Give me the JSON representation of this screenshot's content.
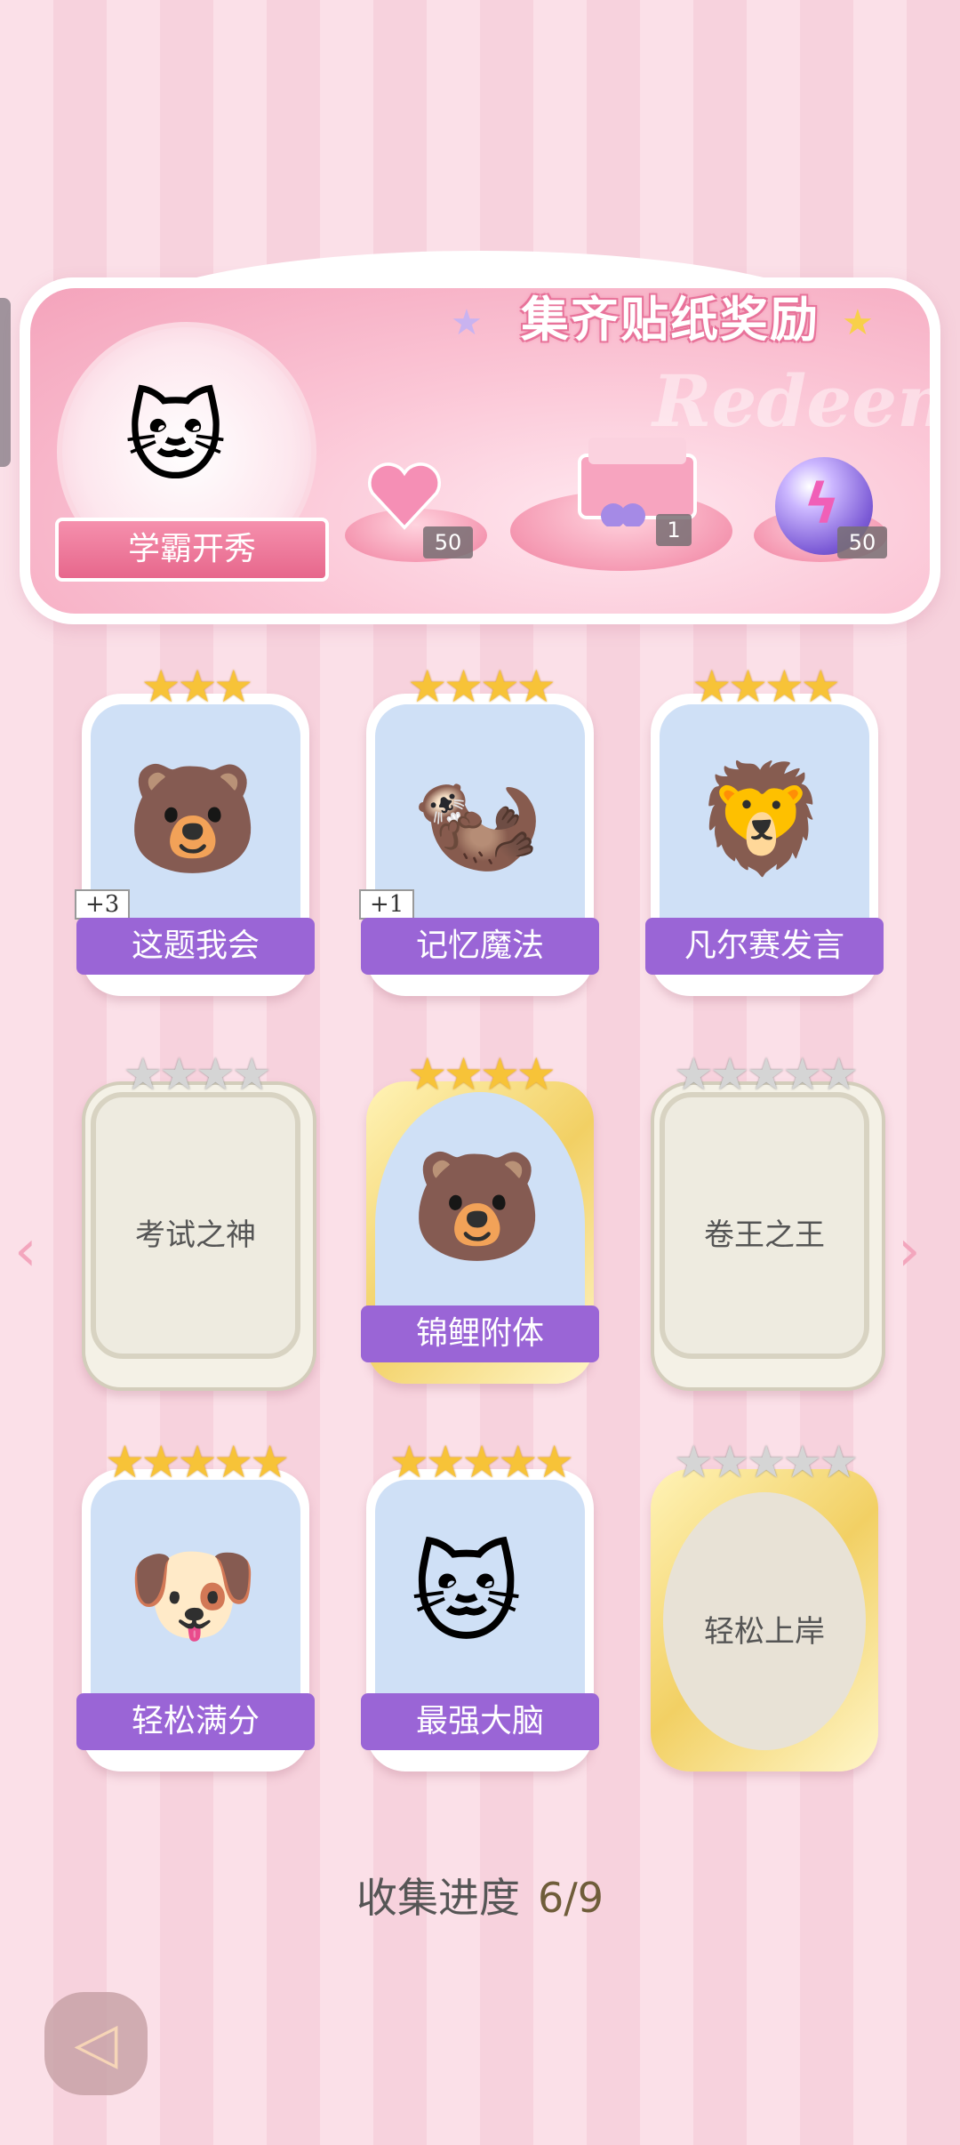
{
  "banner": {
    "title": "集齐贴纸奖励",
    "watermark": "Redeem",
    "medal_label": "学霸开秀",
    "rewards": [
      {
        "name": "pink-heart-gem",
        "count": "50"
      },
      {
        "name": "gift-box",
        "count": "1"
      },
      {
        "name": "lightning-orb",
        "count": "50"
      }
    ]
  },
  "cards": [
    {
      "label": "这题我会",
      "stars": 3,
      "plus": "+3",
      "collected": true,
      "icon": "bear-at-desk"
    },
    {
      "label": "记忆魔法",
      "stars": 4,
      "plus": "+1",
      "collected": true,
      "icon": "wizard-otter"
    },
    {
      "label": "凡尔赛发言",
      "stars": 4,
      "collected": true,
      "icon": "lion-with-mic"
    },
    {
      "label": "考试之神",
      "stars": 4,
      "collected": false
    },
    {
      "label": "锦鲤附体",
      "stars": 4,
      "collected": true,
      "icon": "bear-with-koi"
    },
    {
      "label": "卷王之王",
      "stars": 5,
      "collected": false
    },
    {
      "label": "轻松满分",
      "stars": 5,
      "collected": true,
      "icon": "puppy-full-score"
    },
    {
      "label": "最强大脑",
      "stars": 5,
      "collected": true,
      "icon": "cat-with-papers"
    },
    {
      "label": "轻松上岸",
      "stars": 5,
      "collected": false
    }
  ],
  "progress": {
    "label": "收集进度",
    "value": "6/9"
  }
}
